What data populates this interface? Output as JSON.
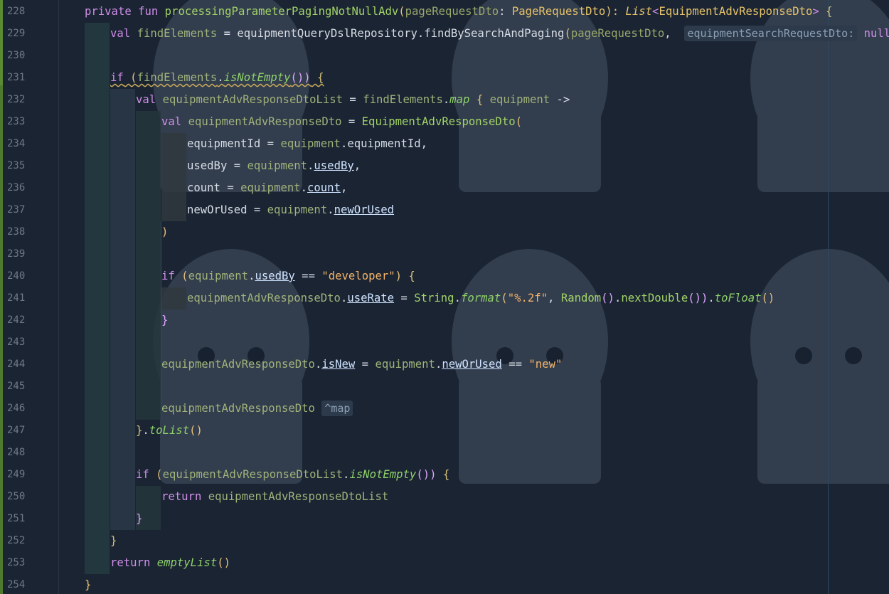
{
  "editor": {
    "line_numbers": [
      "228",
      "229",
      "230",
      "231",
      "232",
      "233",
      "234",
      "235",
      "236",
      "237",
      "238",
      "239",
      "240",
      "241",
      "242",
      "243",
      "244",
      "245",
      "246",
      "247",
      "248",
      "249",
      "250",
      "251",
      "252",
      "253",
      "254"
    ]
  },
  "code": {
    "l228": {
      "private": "private",
      "fun": "fun",
      "name": "processingParameterPagingNotNullAdv",
      "open": "(",
      "param": "pageRequestDto",
      "colon": ": ",
      "ptype": "PageRequestDto",
      "close": "): ",
      "list": "List",
      "lt": "<",
      "rtype": "EquipmentAdvResponseDto",
      "gt": ">",
      "brace": " {"
    },
    "l229": {
      "val": "val",
      "var": "findElements",
      "eq": " = ",
      "repo": "equipmentQueryDslRepository",
      "dot": ".",
      "call": "findBySearchAndPaging",
      "open": "(",
      "arg1": "pageRequestDto",
      "comma": ",",
      "hint": "equipmentSearchRequestDto:",
      "arg2": "null",
      "close": ")"
    },
    "l231": {
      "if": "if",
      "open": " (",
      "var": "findElements",
      "dot": ".",
      "call": "isNotEmpty",
      "close": "())",
      "brace": " {"
    },
    "l232": {
      "val": "val",
      "var": "equipmentAdvResponseDtoList",
      "eq": " = ",
      "recv": "findElements",
      "dot": ".",
      "call": "map",
      "brace": " { ",
      "it": "equipment",
      "arrow": " ->"
    },
    "l233": {
      "val": "val",
      "var": "equipmentAdvResponseDto",
      "eq": " = ",
      "ctor": "EquipmentAdvResponseDto",
      "open": "("
    },
    "l234": {
      "name": "equipmentId",
      "eq": " = ",
      "recv": "equipment",
      "dot": ".",
      "prop": "equipmentId",
      "comma": ","
    },
    "l235": {
      "name": "usedBy",
      "eq": " = ",
      "recv": "equipment",
      "dot": ".",
      "prop": "usedBy",
      "comma": ","
    },
    "l236": {
      "name": "count",
      "eq": " = ",
      "recv": "equipment",
      "dot": ".",
      "prop": "count",
      "comma": ","
    },
    "l237": {
      "name": "newOrUsed",
      "eq": " = ",
      "recv": "equipment",
      "dot": ".",
      "prop": "newOrUsed"
    },
    "l238": {
      "close": ")"
    },
    "l240": {
      "if": "if",
      "open": " (",
      "recv": "equipment",
      "dot": ".",
      "prop": "usedBy",
      "op": " == ",
      "str": "\"developer\"",
      "close": ")",
      "brace": " {"
    },
    "l241": {
      "recv": "equipmentAdvResponseDto",
      "dot": ".",
      "prop": "useRate",
      "eq": " = ",
      "cls": "String",
      "dot2": ".",
      "call": "format",
      "open": "(",
      "str": "\"%.2f\"",
      "comma": ", ",
      "rand": "Random",
      "rcall": "()",
      "dot3": ".",
      "call2": "nextDouble",
      "close": "())",
      "dot4": ".",
      "call3": "toFloat",
      "end": "()"
    },
    "l242": {
      "brace": "}"
    },
    "l244": {
      "recv": "equipmentAdvResponseDto",
      "dot": ".",
      "prop": "isNew",
      "eq": " = ",
      "recv2": "equipment",
      "dot2": ".",
      "prop2": "newOrUsed",
      "op": " == ",
      "str": "\"new\""
    },
    "l246": {
      "recv": "equipmentAdvResponseDto",
      "hint": "^map"
    },
    "l247": {
      "brace": "}",
      "dot": ".",
      "call": "toList",
      "end": "()"
    },
    "l249": {
      "if": "if",
      "open": " (",
      "recv": "equipmentAdvResponseDtoList",
      "dot": ".",
      "call": "isNotEmpty",
      "close": "())",
      "brace": " {"
    },
    "l250": {
      "return": "return",
      "value": " equipmentAdvResponseDtoList"
    },
    "l251": {
      "brace": "}"
    },
    "l252": {
      "brace": "}"
    },
    "l253": {
      "return": "return",
      "call": "emptyList",
      "end": "()"
    },
    "l254": {
      "brace": "}"
    }
  },
  "colors": {
    "background": "#1a2433",
    "keyword": "#cf8ee8",
    "function": "#a3d468",
    "type": "#e8c46a",
    "string": "#f2b36b",
    "gutter_change": "#4f7a2e"
  }
}
